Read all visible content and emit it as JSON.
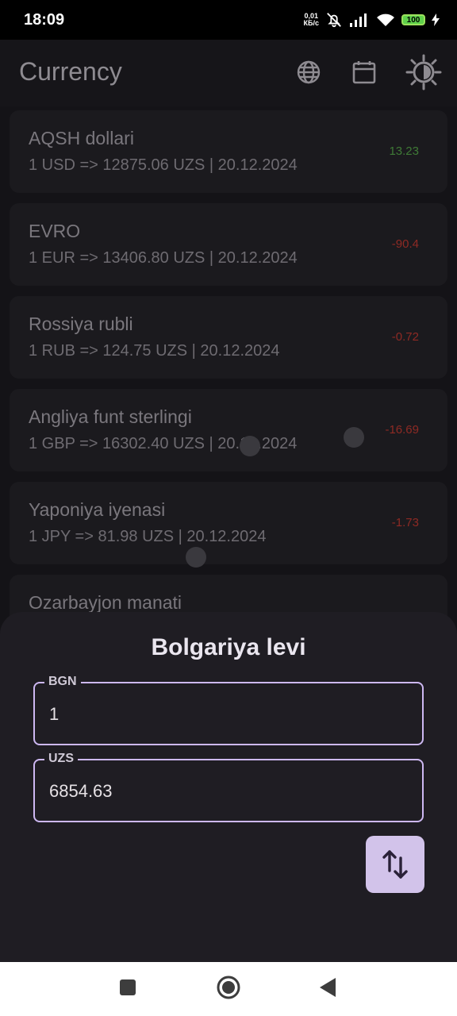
{
  "status_bar": {
    "time": "18:09",
    "net_speed_value": "0,01",
    "net_speed_unit": "КБ/с",
    "battery": "100"
  },
  "app_bar": {
    "title": "Currency",
    "actions": [
      "globe-icon",
      "calendar-icon",
      "brightness-icon"
    ]
  },
  "currencies": [
    {
      "name": "AQSH dollari",
      "rate": "1 USD => 12875.06 UZS | 20.12.2024",
      "diff": "13.23",
      "trend": "up"
    },
    {
      "name": "EVRO",
      "rate": "1 EUR => 13406.80 UZS | 20.12.2024",
      "diff": "-90.4",
      "trend": "down"
    },
    {
      "name": "Rossiya rubli",
      "rate": "1 RUB => 124.75 UZS | 20.12.2024",
      "diff": "-0.72",
      "trend": "down"
    },
    {
      "name": "Angliya funt sterlingi",
      "rate": "1 GBP => 16302.40 UZS | 20.12.2024",
      "diff": "-16.69",
      "trend": "down"
    },
    {
      "name": "Yaponiya iyenasi",
      "rate": "1 JPY => 81.98 UZS | 20.12.2024",
      "diff": "-1.73",
      "trend": "down"
    },
    {
      "name": "Ozarbayjon manati",
      "rate": "",
      "diff": "",
      "trend": ""
    }
  ],
  "converter": {
    "title": "Bolgariya levi",
    "from": {
      "code": "BGN",
      "value": "1"
    },
    "to": {
      "code": "UZS",
      "value": "6854.63"
    },
    "swap_icon": "swap-vertical-icon"
  },
  "nav_bar": [
    "recents-icon",
    "home-icon",
    "back-icon"
  ],
  "colors": {
    "accent": "#cdb8f2",
    "swap_button": "#d2c3ea",
    "positive": "#3f7a36",
    "negative": "#8e2a24"
  }
}
